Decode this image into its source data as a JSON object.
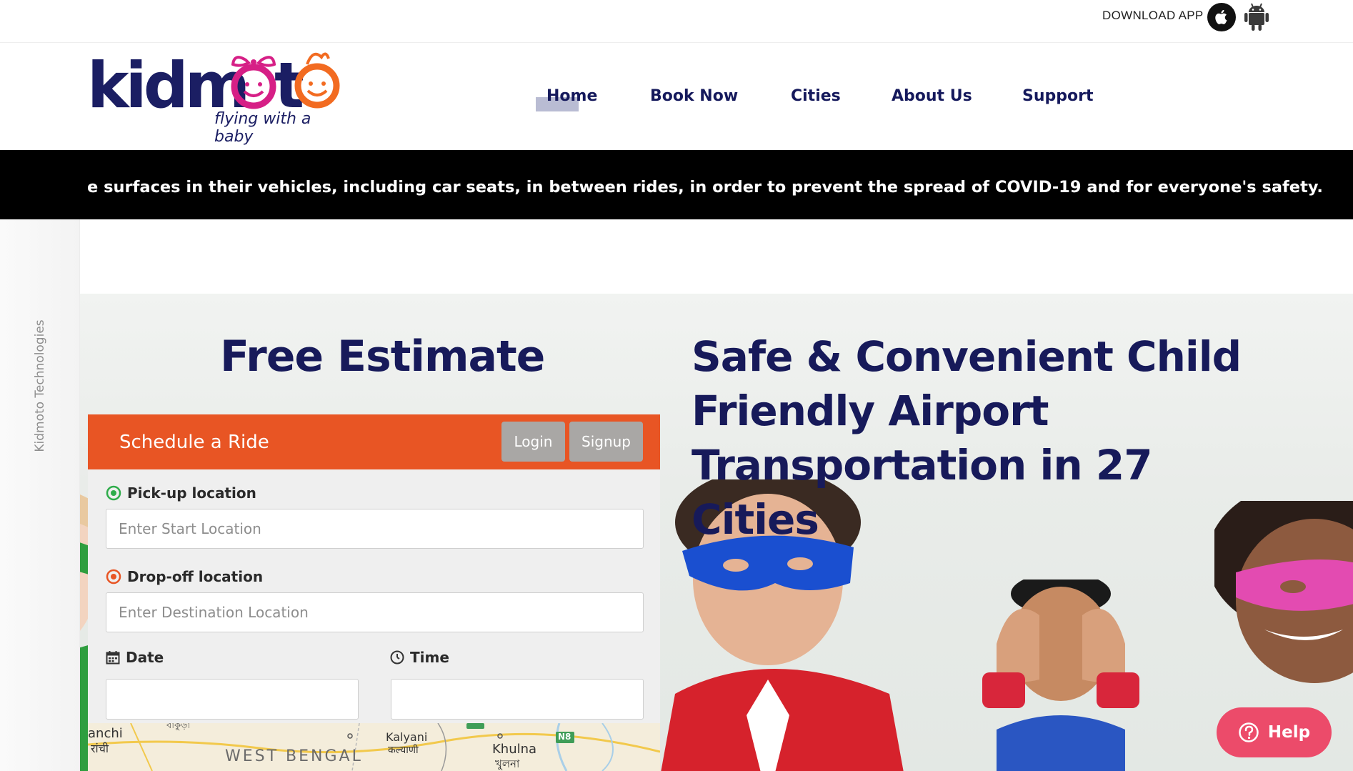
{
  "topbar": {
    "download_label": "DOWNLOAD APP",
    "apple_icon": "apple-icon",
    "android_icon": "android-icon"
  },
  "logo": {
    "wordmark": "kidmoto",
    "tagline": "flying with a baby"
  },
  "nav": {
    "items": [
      {
        "label": "Home"
      },
      {
        "label": "Book Now"
      },
      {
        "label": "Cities"
      },
      {
        "label": "About Us"
      },
      {
        "label": "Support"
      }
    ]
  },
  "ticker": {
    "text": "e surfaces in their vehicles, including car seats, in between rides, in order to prevent the spread of COVID-19 and for everyone's safety."
  },
  "side": {
    "label": "Kidmoto Technologies"
  },
  "hero": {
    "estimate_title": "Free Estimate",
    "tagline": "Safe & Convenient Child Friendly Airport Transportation in 27 Cities"
  },
  "schedule": {
    "title": "Schedule a Ride",
    "login_label": "Login",
    "signup_label": "Signup",
    "pickup": {
      "label": "Pick-up location",
      "placeholder": "Enter Start Location",
      "value": ""
    },
    "dropoff": {
      "label": "Drop-off location",
      "placeholder": "Enter Destination Location",
      "value": ""
    },
    "date": {
      "label": "Date",
      "value": ""
    },
    "time": {
      "label": "Time",
      "value": ""
    }
  },
  "map": {
    "labels": {
      "ranchi": "anchi",
      "ranchi_local": "रांची",
      "region": "WEST BENGAL",
      "kalyani": "Kalyani",
      "kalyani_local": "कल्याणी",
      "khulna": "Khulna",
      "khulna_local": "খুলনা",
      "route_n8": "N8",
      "bankura": "বাঁকুড়া"
    }
  },
  "help": {
    "label": "Help"
  },
  "colors": {
    "brand_navy": "#171a5a",
    "brand_orange": "#e85524",
    "help_pink": "#ec4b6a",
    "ticker_bg": "#000000"
  }
}
